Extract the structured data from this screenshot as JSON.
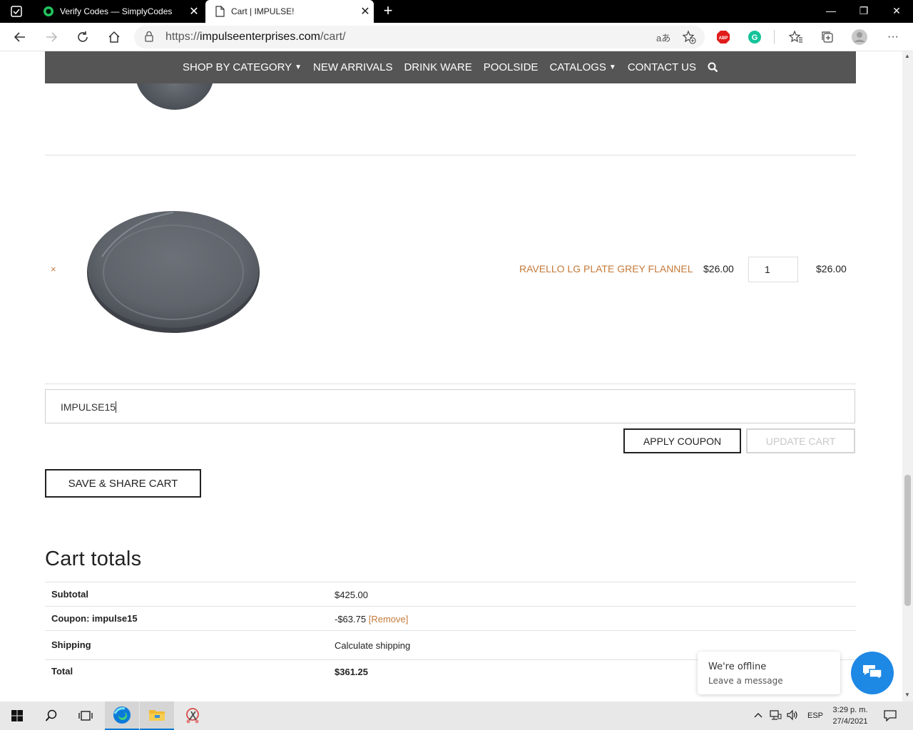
{
  "browser": {
    "tabs": [
      {
        "title": "Verify Codes — SimplyCodes",
        "icon": "simplycodes-icon"
      },
      {
        "title": "Cart | IMPULSE!",
        "icon": "page-icon"
      }
    ],
    "url_prefix": "https://",
    "url_host": "impulseenterprises.com",
    "url_path": "/cart/"
  },
  "site_nav": {
    "items": [
      {
        "label": "SHOP BY CATEGORY",
        "has_dropdown": true
      },
      {
        "label": "NEW ARRIVALS",
        "has_dropdown": false
      },
      {
        "label": "DRINK WARE",
        "has_dropdown": false
      },
      {
        "label": "POOLSIDE",
        "has_dropdown": false
      },
      {
        "label": "CATALOGS",
        "has_dropdown": true
      },
      {
        "label": "CONTACT US",
        "has_dropdown": false
      }
    ]
  },
  "cart_item": {
    "remove": "×",
    "name": "RAVELLO LG PLATE GREY FLANNEL",
    "price": "$26.00",
    "quantity": "1",
    "subtotal": "$26.00"
  },
  "coupon": {
    "value": "IMPULSE15",
    "apply_label": "APPLY COUPON",
    "update_label": "UPDATE CART",
    "save_share_label": "SAVE & SHARE CART"
  },
  "totals": {
    "title": "Cart totals",
    "rows": [
      {
        "label": "Subtotal",
        "value": "$425.00"
      },
      {
        "label": "Coupon: impulse15",
        "value": "-$63.75",
        "link": "[Remove]"
      },
      {
        "label": "Shipping",
        "value": "Calculate shipping"
      },
      {
        "label": "Total",
        "value": "$361.25"
      }
    ]
  },
  "chat": {
    "status": "We're offline",
    "action": "Leave a message"
  },
  "taskbar": {
    "language": "ESP",
    "time": "3:29 p. m.",
    "date": "27/4/2021"
  },
  "colors": {
    "accent": "#c47a3a",
    "nav_bg": "#555555",
    "chat_blue": "#1e88e5"
  }
}
